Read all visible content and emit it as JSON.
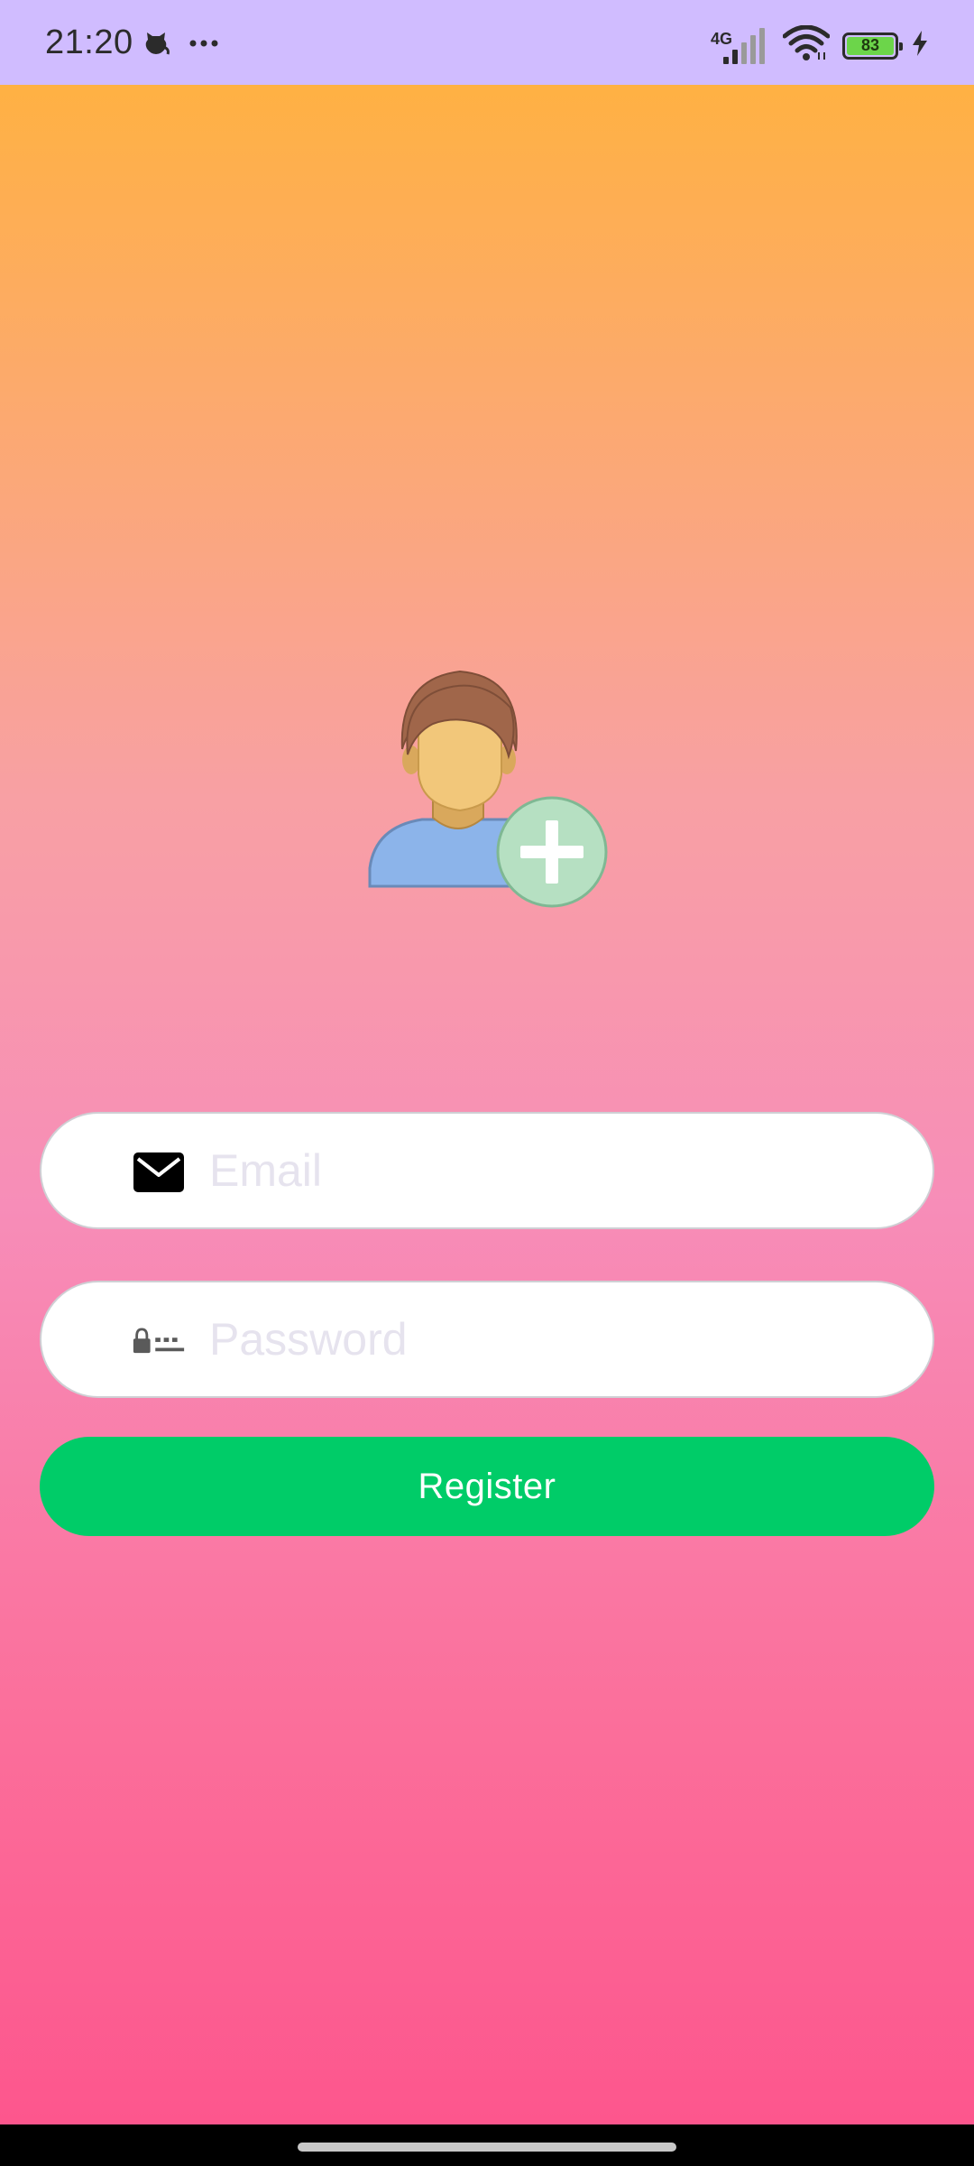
{
  "status_bar": {
    "time": "21:20",
    "network_type": "4G",
    "battery_level": "83",
    "icons": [
      "pet-notification-icon",
      "more-dots-icon",
      "signal-icon",
      "wifi-icon",
      "battery-icon",
      "charging-icon"
    ]
  },
  "avatar": {
    "icon": "add-user-icon"
  },
  "form": {
    "email": {
      "placeholder": "Email",
      "value": "",
      "icon": "envelope-icon"
    },
    "password": {
      "placeholder": "Password",
      "value": "",
      "icon": "password-lock-icon"
    },
    "register_label": "Register"
  },
  "colors": {
    "status_bar": "#d0bcff",
    "gradient_top": "#ffb143",
    "gradient_bottom": "#fd568d",
    "button": "#00cc68",
    "placeholder": "#e6e3ee"
  }
}
